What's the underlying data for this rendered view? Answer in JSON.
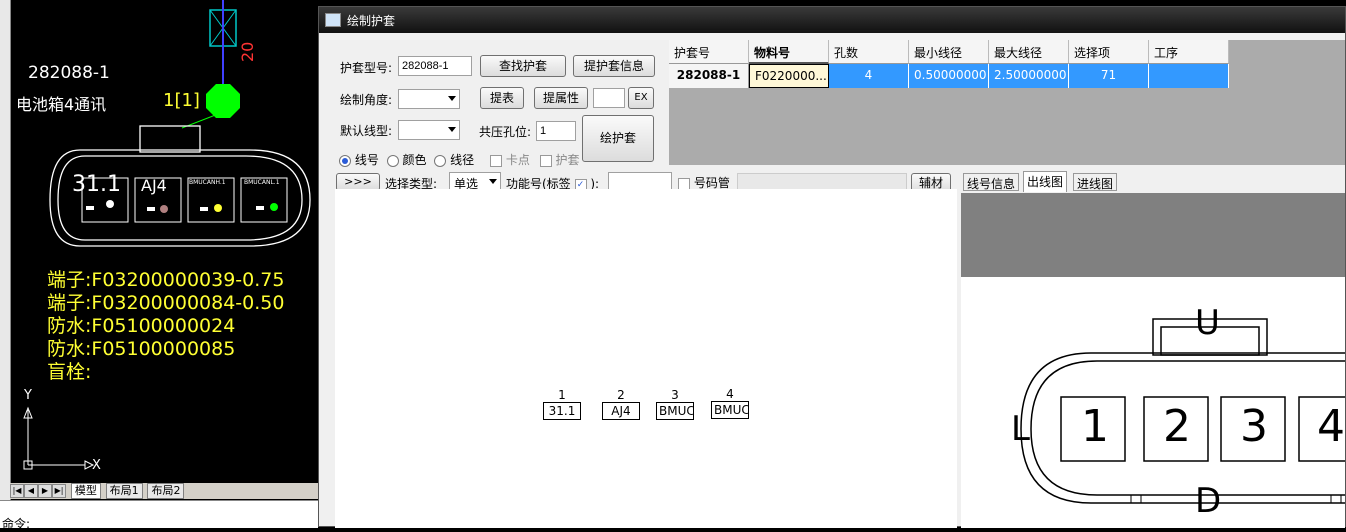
{
  "cad": {
    "part_number": "282088-1",
    "desc": "电池箱4通讯",
    "wire_label": "20",
    "node_label": "1[1]",
    "cavities": [
      "31.1",
      "AJ4",
      "BMUCANH.1",
      "BMUCANL.1"
    ],
    "info_lines": [
      "端子:F03200000039-0.75",
      "端子:F03200000084-0.50",
      "防水:F05100000024",
      "防水:F05100000085",
      "盲栓:"
    ],
    "axis_x": "X",
    "axis_y": "Y",
    "tabs": [
      "模型",
      "布局1",
      "布局2"
    ],
    "command_prompt": "命令:"
  },
  "dialog": {
    "title": "绘制护套",
    "sheath_type_label": "护套型号:",
    "sheath_type_value": "282088-1",
    "find_button": "查找护套",
    "extract_info_button": "提护套信息",
    "angle_label": "绘制角度:",
    "extract_table_button": "提表",
    "extract_attr_button": "提属性",
    "ex_button": "EX",
    "default_linetype_label": "默认线型:",
    "crimp_label": "共压孔位:",
    "crimp_value": "1",
    "draw_button": "绘护套",
    "radios": [
      {
        "label": "线号",
        "checked": true
      },
      {
        "label": "颜色",
        "checked": false
      },
      {
        "label": "线径",
        "checked": false
      }
    ],
    "checks": [
      {
        "label": "卡点",
        "checked": false
      },
      {
        "label": "护套",
        "checked": false
      }
    ],
    "expand_button": ">>>",
    "select_type_label": "选择类型:",
    "select_type_value": "单选",
    "function_label_a": "功能号(标签",
    "function_label_b": "):",
    "function_check": true,
    "tube_label": "号码管",
    "aux_button": "辅材"
  },
  "grid": {
    "headers": [
      "护套号",
      "物料号",
      "孔数",
      "最小线径",
      "最大线径",
      "选择项",
      "工序"
    ],
    "row": [
      "282088-1",
      "F0220000...",
      "4",
      "0.50000000",
      "2.50000000",
      "71",
      ""
    ]
  },
  "pins": [
    {
      "num": "1",
      "label": "31.1"
    },
    {
      "num": "2",
      "label": "AJ4"
    },
    {
      "num": "3",
      "label": "BMUC"
    },
    {
      "num": "4",
      "label": "BMUC"
    }
  ],
  "right_tabs": [
    "线号信息",
    "出线图",
    "进线图"
  ],
  "connector_view": {
    "top": "U",
    "left": "L",
    "bottom": "D",
    "cavities": [
      "1",
      "2",
      "3",
      "4"
    ]
  },
  "colors": {
    "cad_yellow": "#ffff33",
    "cad_green": "#00ff00",
    "cad_red": "#ff3333",
    "selection": "#3399ff"
  }
}
